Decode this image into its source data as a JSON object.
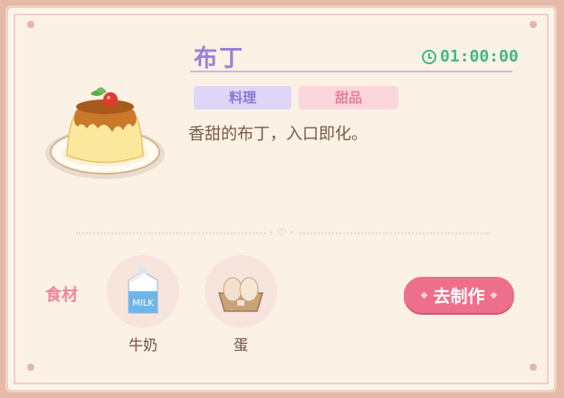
{
  "recipe": {
    "name": "布丁",
    "timer": "01:00:00",
    "tags": [
      "料理",
      "甜品"
    ],
    "description": "香甜的布丁，入口即化。"
  },
  "ingredients": {
    "label": "食材",
    "items": [
      {
        "name": "牛奶",
        "icon": "milk-carton-icon"
      },
      {
        "name": "蛋",
        "icon": "egg-carton-icon"
      }
    ]
  },
  "actions": {
    "make_label": "去制作"
  },
  "colors": {
    "title": "#9b80d6",
    "timer": "#43b889",
    "button": "#ee6f8c",
    "label": "#ef86a3"
  }
}
